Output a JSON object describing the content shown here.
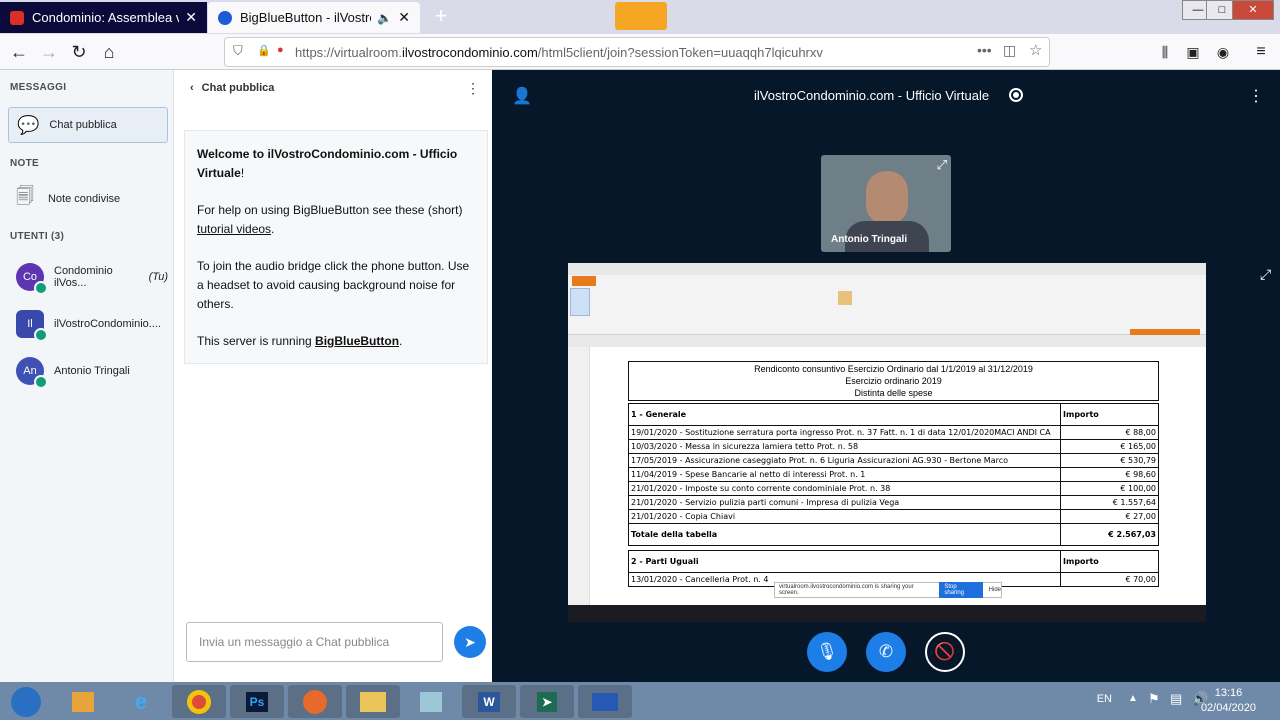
{
  "browser": {
    "tabs": [
      {
        "title": "Condominio: Assemblea virtua"
      },
      {
        "title": "BigBlueButton - ilVostroCon"
      }
    ],
    "url_prefix": "https://virtualroom.",
    "url_host": "ilvostrocondominio.com",
    "url_path": "/html5client/join?sessionToken=uuaqqh7lqicuhrxv"
  },
  "sidebar": {
    "messages_header": "MESSAGGI",
    "public_chat": "Chat pubblica",
    "notes_header": "NOTE",
    "shared_notes": "Note condivise",
    "users_header": "UTENTI (3)",
    "users": [
      {
        "initials": "Co",
        "name": "Condominio ilVos...",
        "suffix": "(Tu)",
        "color": "#5e35b1"
      },
      {
        "initials": "Il",
        "name": "ilVostroCondominio....",
        "suffix": "",
        "color": "#3949ab"
      },
      {
        "initials": "An",
        "name": "Antonio Tringali",
        "suffix": "",
        "color": "#3f51b5"
      }
    ]
  },
  "chat": {
    "header": "Chat pubblica",
    "welcome_prefix": "Welcome to ",
    "welcome_bold": "ilVostroCondominio.com - Ufficio Virtuale",
    "welcome_suffix": "!",
    "help_prefix": "For help on using BigBlueButton see these (short) ",
    "help_link": "tutorial videos",
    "help_suffix": ".",
    "audio_text": "To join the audio bridge click the phone button. Use a headset to avoid causing background noise for others.",
    "server_prefix": "This server is running ",
    "server_link": "BigBlueButton",
    "server_suffix": ".",
    "input_placeholder": "Invia un messaggio a Chat pubblica"
  },
  "meeting": {
    "title": "ilVostroCondominio.com - Ufficio Virtuale",
    "webcam_name": "Antonio Tringali"
  },
  "document": {
    "title_lines": [
      "Rendiconto consuntivo Esercizio Ordinario dal 1/1/2019 al 31/12/2019",
      "Esercizio ordinario 2019",
      "Distinta delle spese"
    ],
    "section1": {
      "name": "1 - Generale",
      "amount_header": "Importo"
    },
    "rows": [
      {
        "desc": "19/01/2020 - Sostituzione serratura porta ingresso Prot. n. 37 Fatt. n. 1 di data 12/01/2020MACI ANDI CA",
        "amount": "€ 88,00"
      },
      {
        "desc": "10/03/2020 - Messa in sicurezza lamiera tetto Prot. n. 58",
        "amount": "€ 165,00"
      },
      {
        "desc": "17/05/2019 - Assicurazione caseggiato Prot. n. 6 Liguria Assicurazioni AG.930 - Bertone Marco",
        "amount": "€ 530,79"
      },
      {
        "desc": "11/04/2019 - Spese Bancarie al netto di interessi Prot. n. 1",
        "amount": "€ 98,60"
      },
      {
        "desc": "21/01/2020 - Imposte su conto corrente condominiale Prot. n. 38",
        "amount": "€ 100,00"
      },
      {
        "desc": "21/01/2020 - Servizio pulizia parti comuni - Impresa di pulizia Vega",
        "amount": "€ 1.557,64"
      },
      {
        "desc": "21/01/2020 - Copia Chiavi",
        "amount": "€ 27,00"
      }
    ],
    "total_label": "Totale della tabella",
    "total_amount": "€ 2.567,03",
    "section2": {
      "name": "2 - Parti Uguali",
      "amount_header": "Importo"
    },
    "row2": {
      "desc": "13/01/2020 - Cancelleria Prot. n. 4",
      "amount": "€ 70,00"
    },
    "share_notice": "virtualroom.ilvostrocondominio.com is sharing your screen.",
    "stop_sharing": "Stop sharing",
    "hide": "Hide"
  },
  "taskbar": {
    "lang": "EN",
    "time": "13:16",
    "date": "02/04/2020"
  }
}
